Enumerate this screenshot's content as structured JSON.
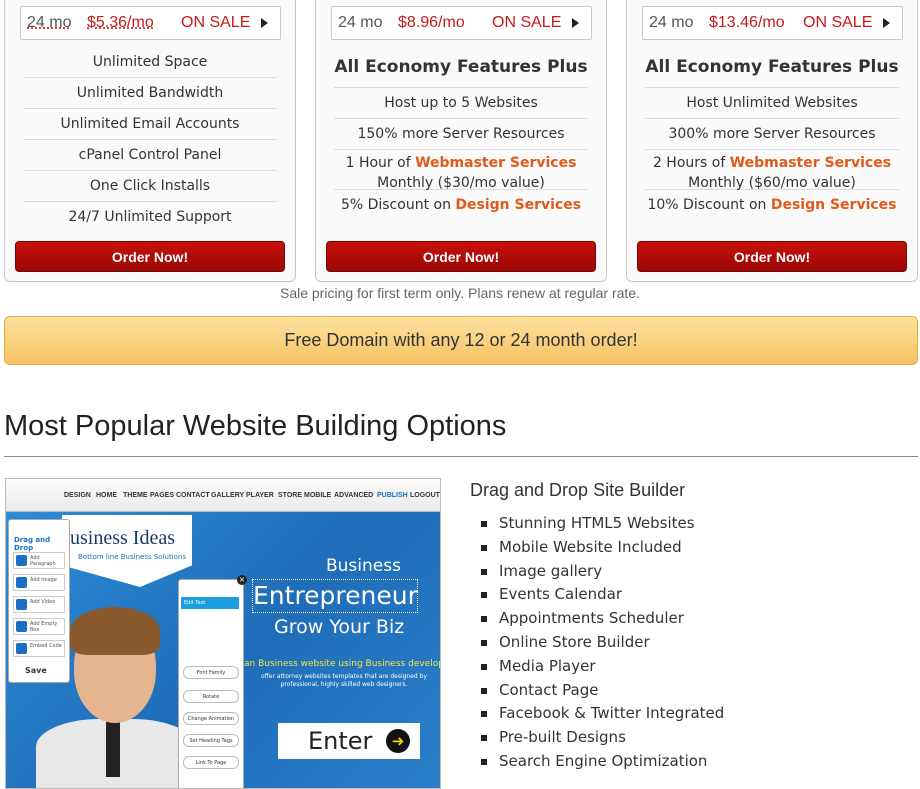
{
  "plans": [
    {
      "term": "24 mo",
      "price": "$5.36/mo",
      "sale": "ON SALE",
      "features": [
        "Unlimited Space",
        "Unlimited Bandwidth",
        "Unlimited Email Accounts",
        "cPanel Control Panel",
        "One Click Installs",
        "24/7 Unlimited Support"
      ],
      "order_label": "Order Now!"
    },
    {
      "term": "24 mo",
      "price": "$8.96/mo",
      "sale": "ON SALE",
      "heading": "All Economy Features Plus",
      "features": [
        "Host up to 5 Websites",
        "150% more Server Resources"
      ],
      "webmaster": {
        "pre": "1 Hour of ",
        "link": "Webmaster Services",
        "post": "Monthly ($30/mo value)"
      },
      "design": {
        "pre": "5% Discount on ",
        "link": "Design Services"
      },
      "order_label": "Order Now!"
    },
    {
      "term": "24 mo",
      "price": "$13.46/mo",
      "sale": "ON SALE",
      "heading": "All Economy Features Plus",
      "features": [
        "Host Unlimited Websites",
        "300% more Server Resources"
      ],
      "webmaster": {
        "pre": "2 Hours of ",
        "link": "Webmaster Services",
        "post": "Monthly ($60/mo value)"
      },
      "design": {
        "pre": "10% Discount on ",
        "link": "Design Services"
      },
      "order_label": "Order Now!"
    }
  ],
  "sale_note": "Sale pricing for first term only. Plans renew at regular rate.",
  "domain_banner": "Free Domain with any 12 or 24 month order!",
  "section_title": "Most Popular Website Building Options",
  "screenshot": {
    "nav": [
      "DESIGN",
      "HOME",
      "THEME",
      "PAGES",
      "CONTACT",
      "GALLERY",
      "PLAYER",
      "STORE",
      "MOBILE",
      "ADVANCED",
      "PUBLISH",
      "LOGOUT"
    ],
    "hero_title": "usiness Ideas",
    "hero_sub": "Bottom line Business Solutions",
    "panel_title": "Drag and Drop",
    "panel_items": [
      "Add Paragraph",
      "Add Image",
      "Add Video",
      "Add Empty Box",
      "Embed Code"
    ],
    "panel_save": "Save",
    "edit_label": "Edit Text",
    "edit_buttons": [
      "Font Family",
      "Rotate",
      "Change Animation",
      "Set Heading Tags",
      "Link To Page"
    ],
    "business": "Business",
    "entrepreneur": "Entrepreneur",
    "grow": "Grow Your Biz",
    "yellow_line": "an Business website using Business develop",
    "white_line": "offer attorney websites templates that are designed by professional, highly skilled web designers.",
    "enter": "Enter",
    "close": "×"
  },
  "builder": {
    "title": "Drag and Drop Site Builder",
    "items": [
      "Stunning HTML5 Websites",
      "Mobile Website Included",
      "Image gallery",
      "Events Calendar",
      "Appointments Scheduler",
      "Online Store Builder",
      "Media Player",
      "Contact Page",
      "Facebook & Twitter Integrated",
      "Pre-built Designs",
      "Search Engine Optimization"
    ]
  },
  "colors": {
    "sale_red": "#c81a1a",
    "order_red": "#b00c08",
    "highlight_orange": "#e05a1c",
    "banner_orange": "#f7c262"
  }
}
